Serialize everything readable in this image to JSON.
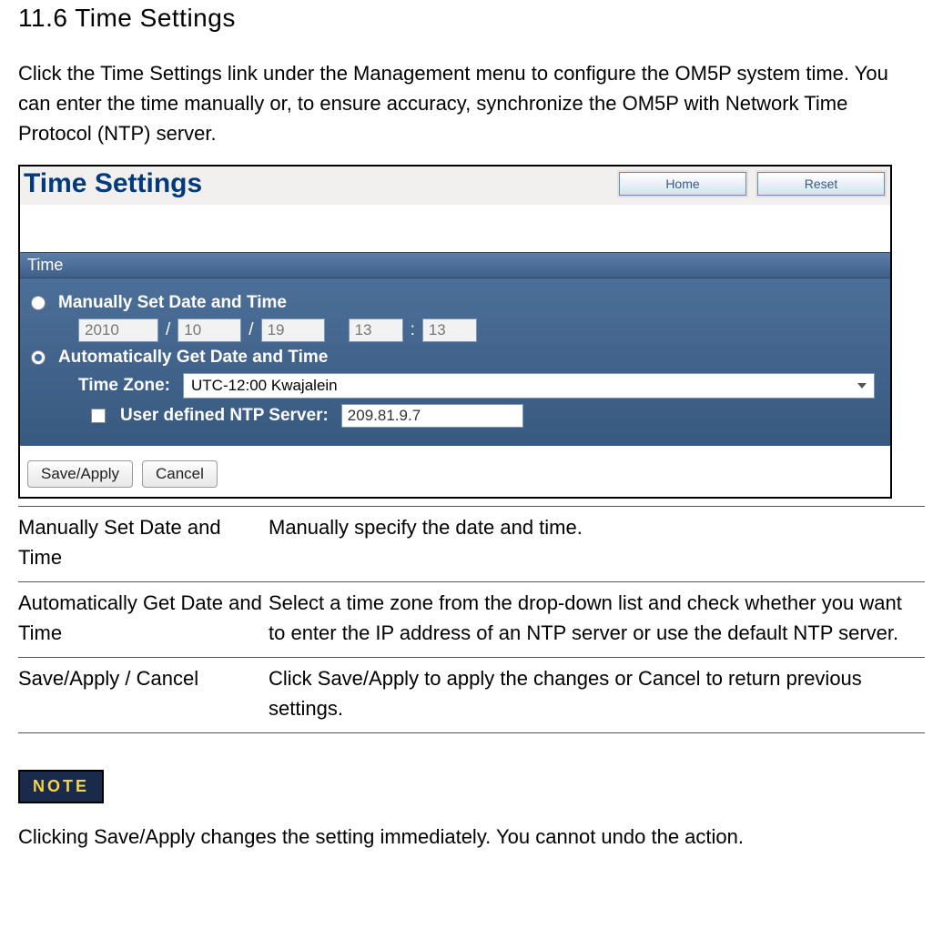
{
  "heading": "11.6 Time Settings",
  "intro": "Click the Time Settings link under the Management menu to configure the OM5P system time. You can enter the time manually or, to ensure accuracy, synchronize the OM5P with Network Time Protocol (NTP) server.",
  "panel": {
    "title": "Time Settings",
    "home": "Home",
    "reset": "Reset",
    "section": "Time",
    "manual_label": "Manually Set Date and Time",
    "year": "2010",
    "month": "10",
    "day": "19",
    "hour": "13",
    "minute": "13",
    "auto_label": "Automatically Get Date and Time",
    "tz_label": "Time Zone:",
    "tz_value": "UTC-12:00 Kwajalein",
    "ntp_label": "User defined NTP Server:",
    "ntp_value": "209.81.9.7",
    "save": "Save/Apply",
    "cancel": "Cancel"
  },
  "table": [
    {
      "k": "Manually Set Date and Time",
      "v": "Manually specify the date and time."
    },
    {
      "k": "Automatically Get Date and Time",
      "v": "Select a time zone from the drop-down  list and check whether you want to enter the IP address of an NTP server or use the default NTP server."
    },
    {
      "k": "Save/Apply / Cancel",
      "v": "Click Save/Apply to apply the changes or Cancel to return previous settings."
    }
  ],
  "note_badge": "NOTE",
  "note_text": "Clicking Save/Apply changes the setting immediately. You cannot undo the action."
}
